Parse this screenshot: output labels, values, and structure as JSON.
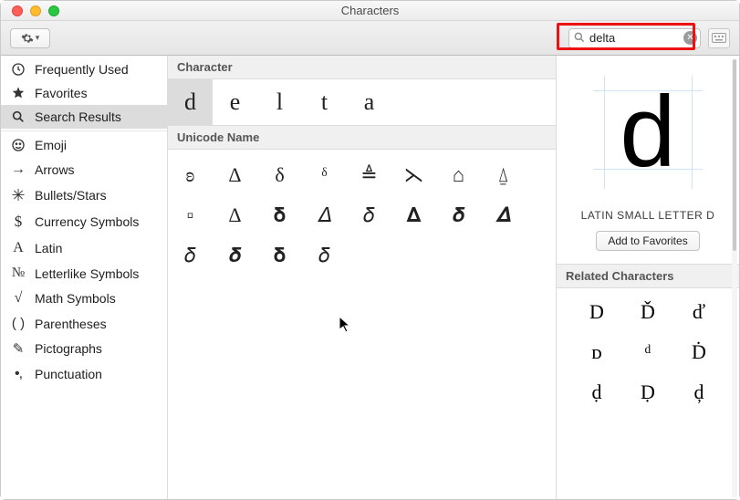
{
  "window": {
    "title": "Characters"
  },
  "search": {
    "value": "delta"
  },
  "sidebar": {
    "groups": [
      [
        {
          "icon": "clock",
          "label": "Frequently Used"
        },
        {
          "icon": "star",
          "label": "Favorites"
        },
        {
          "icon": "search",
          "label": "Search Results",
          "selected": true
        }
      ],
      [
        {
          "icon": "emoji",
          "label": "Emoji"
        },
        {
          "icon": "arrow",
          "label": "Arrows"
        },
        {
          "icon": "bullets",
          "label": "Bullets/Stars"
        },
        {
          "icon": "currency",
          "label": "Currency Symbols"
        },
        {
          "icon": "latin",
          "label": "Latin"
        },
        {
          "icon": "letterlike",
          "label": "Letterlike Symbols"
        },
        {
          "icon": "math",
          "label": "Math Symbols"
        },
        {
          "icon": "parentheses",
          "label": "Parentheses"
        },
        {
          "icon": "pictographs",
          "label": "Pictographs"
        },
        {
          "icon": "punctuation",
          "label": "Punctuation"
        }
      ]
    ]
  },
  "sections": {
    "character_label": "Character",
    "unicode_name_label": "Unicode Name"
  },
  "character_results": [
    "d",
    "e",
    "l",
    "t",
    "a"
  ],
  "unicode_results": [
    "ʚ",
    "Δ",
    "δ",
    "ᵟ",
    "≜",
    "⋋",
    "⌂",
    "⍙",
    "▫",
    "∆",
    "𝛅",
    "𝛥",
    "𝛿",
    "𝚫",
    "𝜹",
    "𝜟",
    "𝛿",
    "𝜹",
    "𝛅",
    "𝛿"
  ],
  "detail": {
    "glyph": "d",
    "name": "LATIN SMALL LETTER D",
    "add_favorites_label": "Add to Favorites",
    "related_label": "Related Characters",
    "related": [
      "D",
      "Ď",
      "ď",
      "ᴅ",
      "ᵈ",
      "Ḋ",
      "ḍ",
      "Ḍ",
      "ḑ"
    ]
  }
}
